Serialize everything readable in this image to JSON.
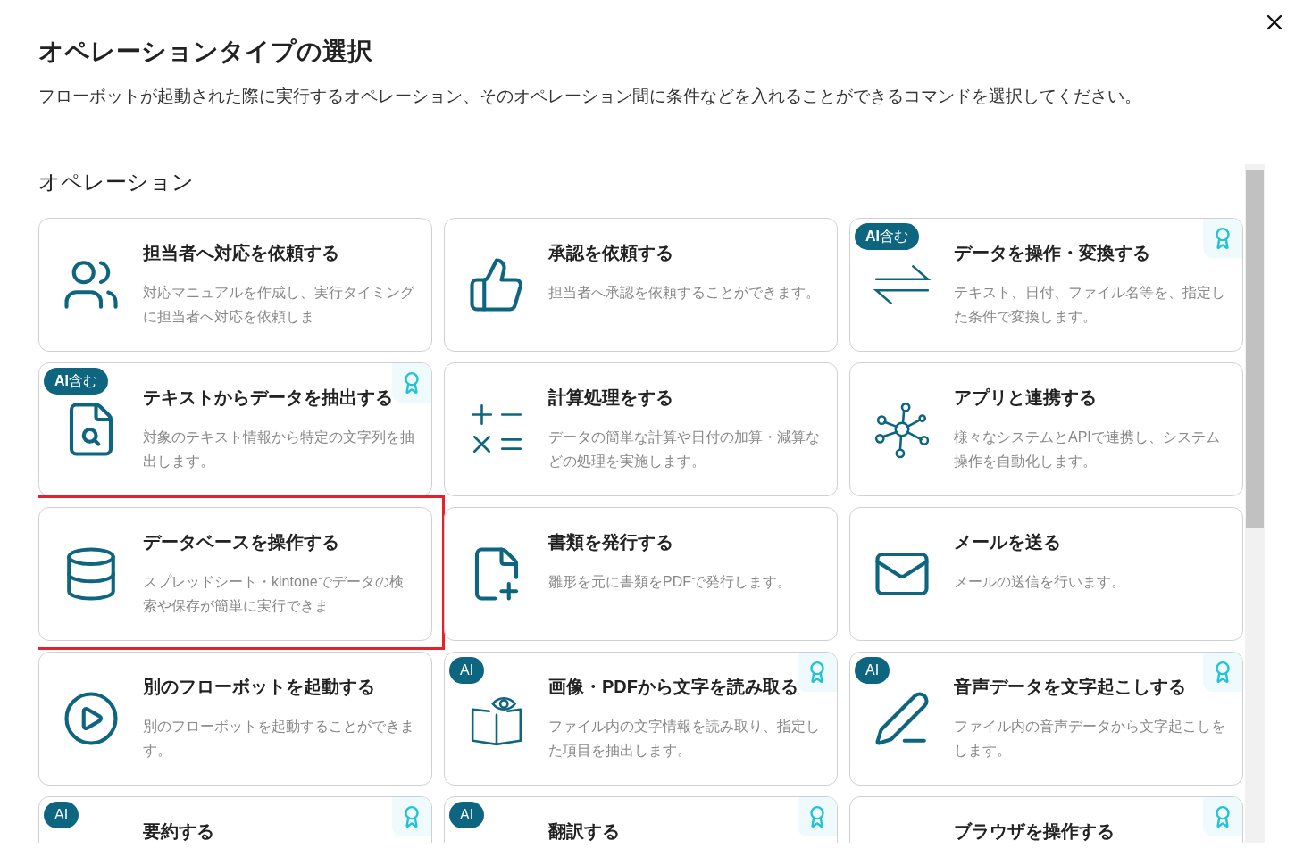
{
  "dialog": {
    "title": "オペレーションタイプの選択",
    "description": "フローボットが起動された際に実行するオペレーション、そのオペレーション間に条件などを入れることができるコマンドを選択してください。"
  },
  "section": {
    "title": "オペレーション"
  },
  "cards": [
    {
      "title": "担当者へ対応を依頼する",
      "description": "対応マニュアルを作成し、実行タイミングに担当者へ対応を依頼しま",
      "kind": "people",
      "premium": false,
      "selected": false
    },
    {
      "title": "承認を依頼する",
      "description": "担当者へ承認を依頼することができます。",
      "kind": "thumbs-up",
      "premium": false,
      "selected": false
    },
    {
      "title": "データを操作・変換する",
      "description": "テキスト、日付、ファイル名等を、指定した条件で変換します。",
      "kind": "exchange",
      "badge": "**AI**含む",
      "premium": true,
      "selected": false
    },
    {
      "title": "テキストからデータを抽出する",
      "description": "対象のテキスト情報から特定の文字列を抽出します。",
      "kind": "doc-search",
      "badge": "**AI**含む",
      "premium": true,
      "selected": false
    },
    {
      "title": "計算処理をする",
      "description": "データの簡単な計算や日付の加算・減算などの処理を実施します。",
      "kind": "calc",
      "premium": false,
      "selected": false
    },
    {
      "title": "アプリと連携する",
      "description": "様々なシステムとAPIで連携し、システム操作を自動化します。",
      "kind": "hub",
      "premium": false,
      "selected": false
    },
    {
      "title": "データベースを操作する",
      "description": "スプレッドシート・kintoneでデータの検索や保存が簡単に実行できま",
      "kind": "database",
      "premium": false,
      "selected": true
    },
    {
      "title": "書類を発行する",
      "description": "雛形を元に書類をPDFで発行します。",
      "kind": "doc-add",
      "premium": false,
      "selected": false
    },
    {
      "title": "メールを送る",
      "description": "メールの送信を行います。",
      "kind": "mail",
      "premium": false,
      "selected": false
    },
    {
      "title": "別のフローボットを起動する",
      "description": "別のフローボットを起動することができます。",
      "kind": "play",
      "premium": false,
      "selected": false
    },
    {
      "title": "画像・PDFから文字を読み取る",
      "description": "ファイル内の文字情報を読み取り、指定した項目を抽出します。",
      "kind": "book-eye",
      "badge": "AI",
      "premium": true,
      "selected": false
    },
    {
      "title": "音声データを文字起こしする",
      "description": "ファイル内の音声データから文字起こしをします。",
      "kind": "pen",
      "badge": "AI",
      "premium": true,
      "selected": false
    },
    {
      "title": "要約する",
      "badge": "AI",
      "premium": true,
      "selected": false
    },
    {
      "title": "翻訳する",
      "badge": "AI",
      "premium": true,
      "selected": false
    },
    {
      "title": "ブラウザを操作する",
      "premium": true,
      "selected": false
    }
  ]
}
